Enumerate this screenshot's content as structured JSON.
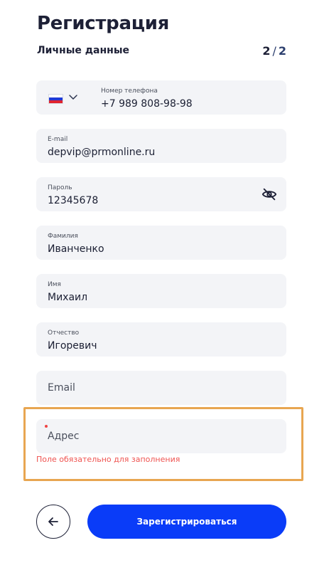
{
  "header": {
    "title": "Регистрация",
    "subtitle": "Личные данные",
    "step_current": "2",
    "step_separator": "/",
    "step_total": "2"
  },
  "fields": {
    "phone": {
      "country_icon": "russia-flag-icon",
      "label": "Номер телефона",
      "value": "+7 989 808-98-98"
    },
    "email": {
      "label": "E-mail",
      "value": "depvip@prmonline.ru"
    },
    "password": {
      "label": "Пароль",
      "value": "12345678",
      "toggle_icon": "eye-off-icon"
    },
    "last_name": {
      "label": "Фамилия",
      "value": "Иванченко"
    },
    "first_name": {
      "label": "Имя",
      "value": "Михаил"
    },
    "patronymic": {
      "label": "Отчество",
      "value": "Игоревич"
    },
    "email2": {
      "placeholder": "Email"
    },
    "address": {
      "placeholder": "Адрес",
      "error": "Поле обязательно для заполнения"
    }
  },
  "actions": {
    "back_icon": "arrow-left-icon",
    "submit_label": "Зарегистрироваться"
  },
  "colors": {
    "accent": "#0a3cf8",
    "error": "#ef5350",
    "highlight": "#e8a651",
    "field_bg": "#f3f4f7"
  }
}
